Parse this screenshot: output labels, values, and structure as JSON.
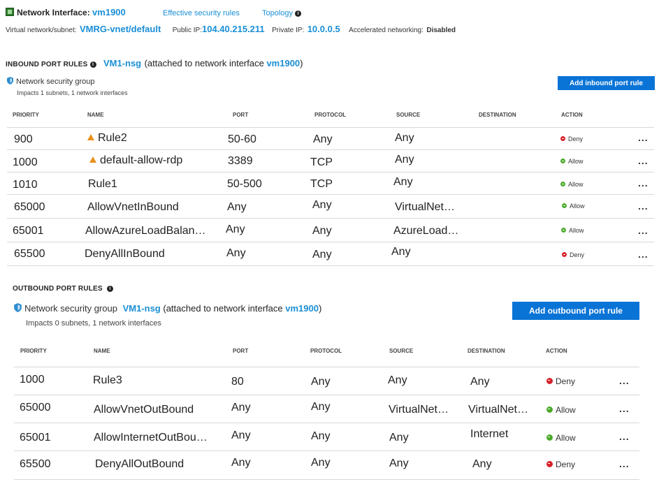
{
  "header": {
    "nic_label": "Network Interface:",
    "nic_name": "vm1900",
    "effective_rules_link": "Effective security rules",
    "topology_link": "Topology",
    "vnet_label": "Virtual network/subnet:",
    "vnet_value": "VMRG-vnet/default",
    "public_ip_label": "Public IP:",
    "public_ip_value": "104.40.215.211",
    "private_ip_label": "Private IP:",
    "private_ip_value": "10.0.0.5",
    "accel_label": "Accelerated networking:",
    "accel_value": "Disabled"
  },
  "inbound": {
    "title": "INBOUND PORT RULES",
    "nsg_name": "VM1-nsg",
    "attached_prefix": "(attached to network interface ",
    "attached_nic": "vm1900",
    "attached_suffix": ")",
    "nsg_label": "Network security group",
    "impacts": "Impacts 1 subnets, 1 network interfaces",
    "add_button": "Add inbound port rule",
    "columns": [
      "PRIORITY",
      "NAME",
      "PORT",
      "PROTOCOL",
      "SOURCE",
      "DESTINATION",
      "ACTION"
    ],
    "rows": [
      {
        "priority": "900",
        "name": "Rule2",
        "port": "50-60",
        "protocol": "Any",
        "source": "Any",
        "destination": "",
        "action": "Deny"
      },
      {
        "priority": "1000",
        "name": "default-allow-rdp",
        "port": "3389",
        "protocol": "TCP",
        "source": "Any",
        "destination": "",
        "action": "Allow"
      },
      {
        "priority": "1010",
        "name": "Rule1",
        "port": "50-500",
        "protocol": "TCP",
        "source": "Any",
        "destination": "",
        "action": "Allow"
      },
      {
        "priority": "65000",
        "name": "AllowVnetInBound",
        "port": "Any",
        "protocol": "Any",
        "source": "VirtualNet…",
        "destination": "",
        "action": "Allow"
      },
      {
        "priority": "65001",
        "name": "AllowAzureLoadBalan…",
        "port": "Any",
        "protocol": "Any",
        "source": "AzureLoad…",
        "destination": "",
        "action": "Allow"
      },
      {
        "priority": "65500",
        "name": "DenyAllInBound",
        "port": "Any",
        "protocol": "Any",
        "source": "Any",
        "destination": "",
        "action": "Deny"
      }
    ]
  },
  "outbound": {
    "title": "OUTBOUND PORT RULES",
    "nsg_label": "Network security group",
    "nsg_name": "VM1-nsg",
    "attached_prefix": "(attached to network interface ",
    "attached_nic": "vm1900",
    "attached_suffix": ")",
    "impacts": "Impacts 0 subnets, 1 network interfaces",
    "add_button": "Add outbound port rule",
    "columns": [
      "PRIORITY",
      "NAME",
      "PORT",
      "PROTOCOL",
      "SOURCE",
      "DESTINATION",
      "ACTION"
    ],
    "rows": [
      {
        "priority": "1000",
        "name": "Rule3",
        "port": "80",
        "protocol": "Any",
        "source": "Any",
        "destination": "Any",
        "action": "Deny"
      },
      {
        "priority": "65000",
        "name": "AllowVnetOutBound",
        "port": "Any",
        "protocol": "Any",
        "source": "VirtualNet…",
        "destination": "VirtualNet…",
        "action": "Allow"
      },
      {
        "priority": "65001",
        "name": "AllowInternetOutBou…",
        "port": "Any",
        "protocol": "Any",
        "source": "Any",
        "destination": "Internet",
        "action": "Allow"
      },
      {
        "priority": "65500",
        "name": "DenyAllOutBound",
        "port": "Any",
        "protocol": "Any",
        "source": "Any",
        "destination": "Any",
        "action": "Deny"
      }
    ]
  },
  "more_glyph": "...",
  "colors": {
    "link": "#1a8fd6",
    "button": "#0a74d6",
    "deny": "#d6232a",
    "allow": "#4caa2c",
    "warning": "#e8911c"
  }
}
